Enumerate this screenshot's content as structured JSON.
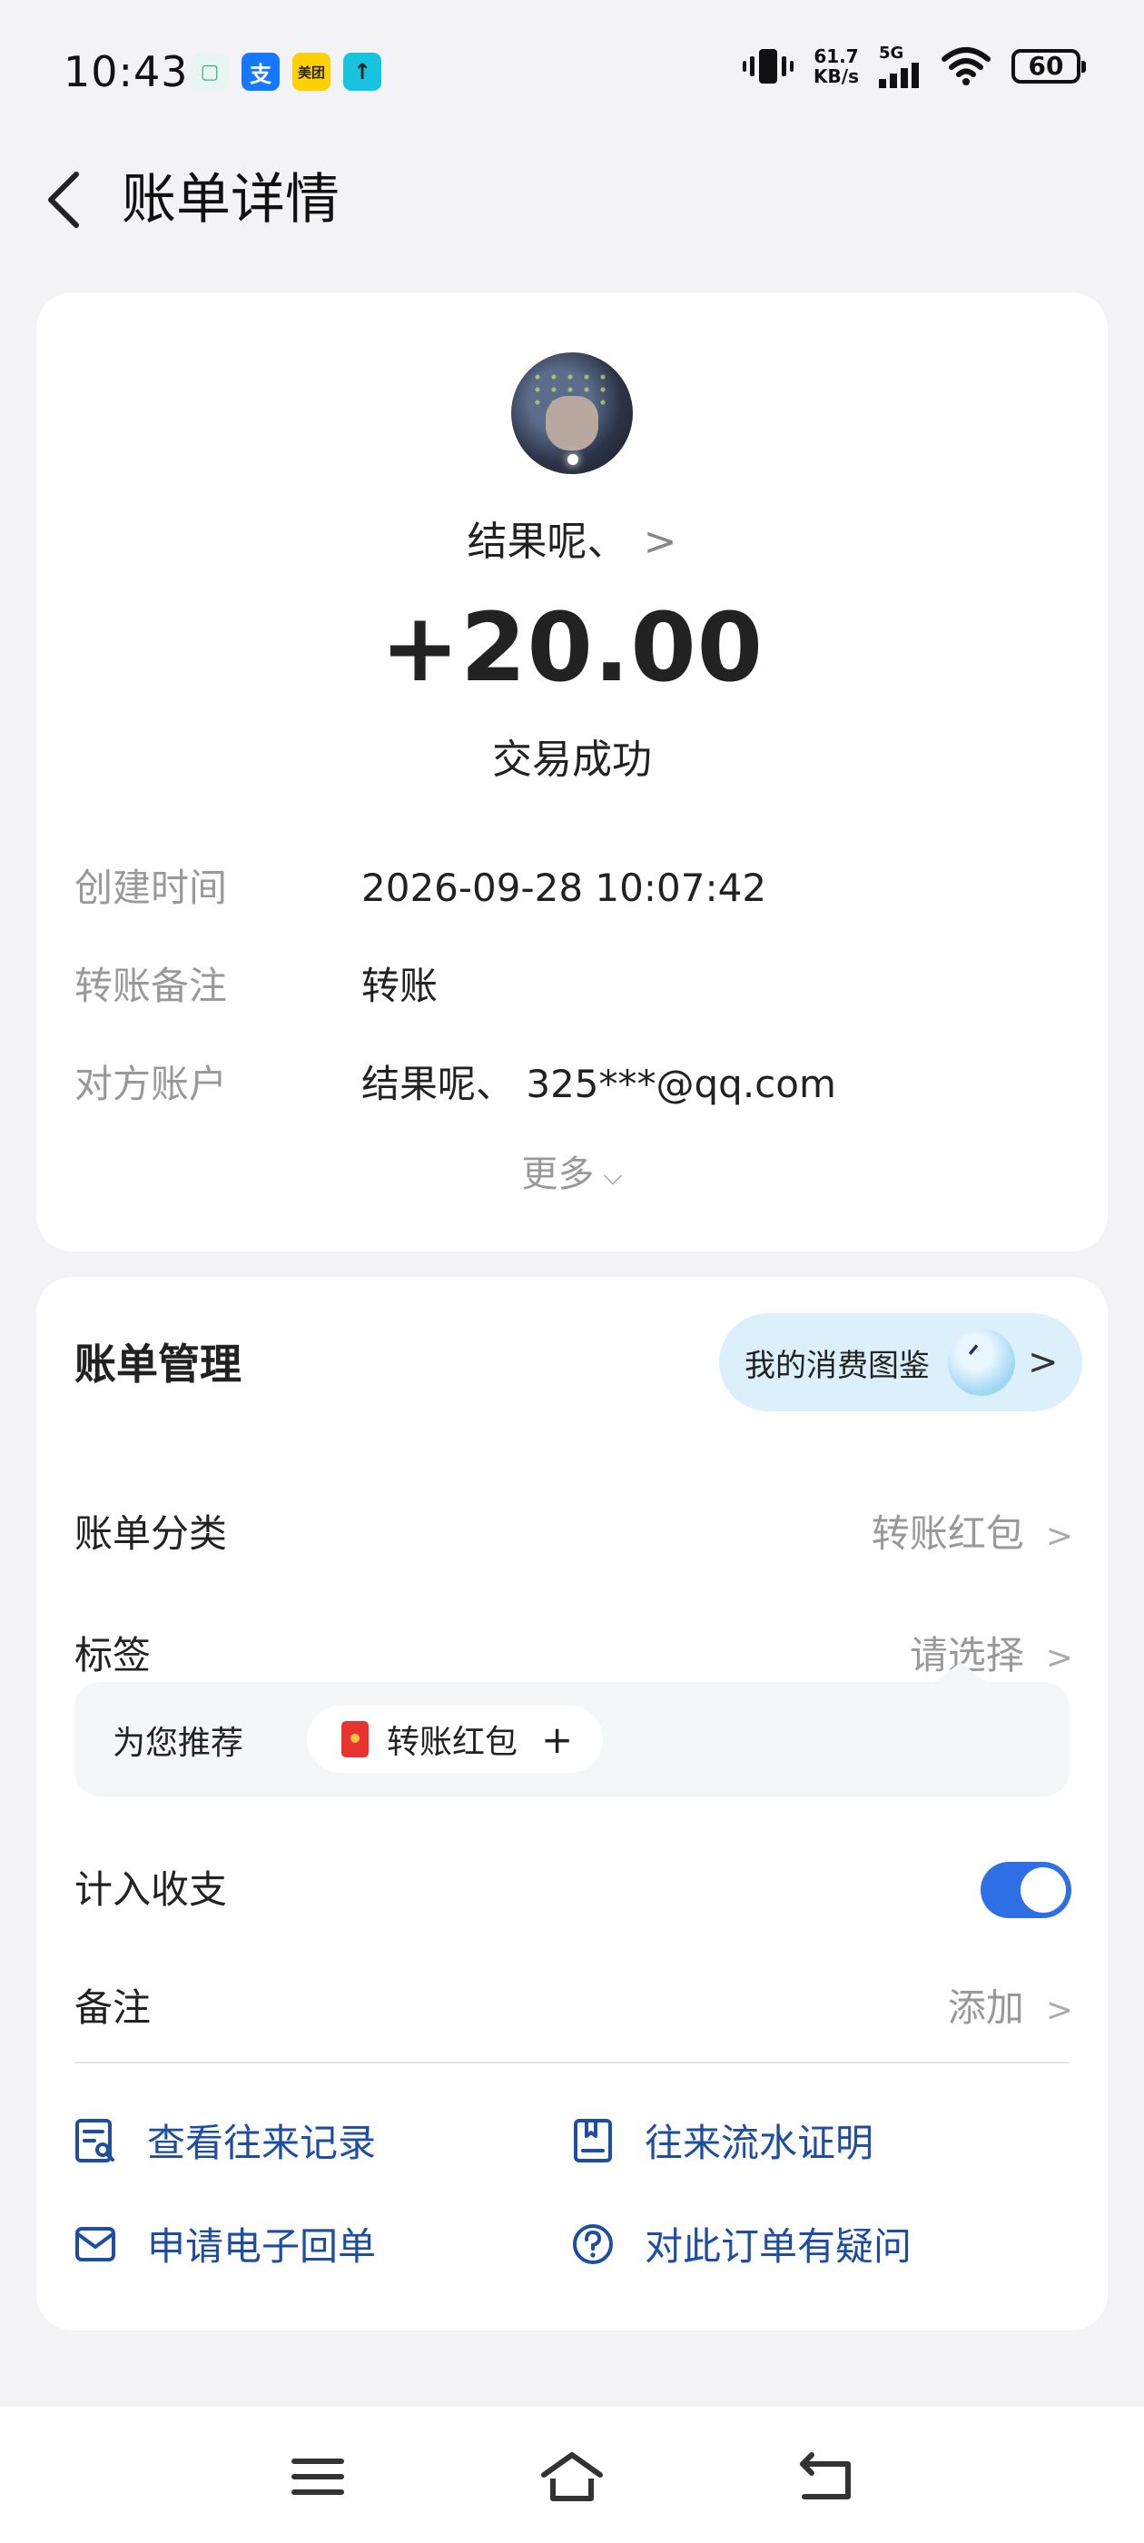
{
  "status_bar": {
    "time": "10:43",
    "apps": [
      {
        "icon": "message-app-icon",
        "glyph": "▢"
      },
      {
        "icon": "alipay-app-icon",
        "glyph": "支"
      },
      {
        "icon": "meituan-app-icon",
        "glyph": "美团"
      },
      {
        "icon": "upload-app-icon",
        "glyph": "↑"
      }
    ],
    "net_speed_value": "61.7",
    "net_speed_unit": "KB/s",
    "network": "5G",
    "battery": "60"
  },
  "header": {
    "title": "账单详情"
  },
  "transaction": {
    "name": "结果呢、",
    "amount": "+20.00",
    "status": "交易成功",
    "details": [
      {
        "key": "创建时间",
        "value": "2026-09-28 10:07:42"
      },
      {
        "key": "转账备注",
        "value": "转账"
      },
      {
        "key": "对方账户",
        "value": "结果呢、 325***@qq.com"
      }
    ],
    "more_label": "更多"
  },
  "management": {
    "title": "账单管理",
    "pill_label": "我的消费图鉴",
    "category_label": "账单分类",
    "category_value": "转账红包",
    "tag_label": "标签",
    "tag_value": "请选择",
    "reco_label": "为您推荐",
    "reco_chip": "转账红包",
    "include_label": "计入收支",
    "include_on": true,
    "note_label": "备注",
    "note_value": "添加",
    "actions": [
      {
        "label": "查看往来记录",
        "icon": "records-search-icon"
      },
      {
        "label": "往来流水证明",
        "icon": "statement-proof-icon"
      },
      {
        "label": "申请电子回单",
        "icon": "mail-receipt-icon"
      },
      {
        "label": "对此订单有疑问",
        "icon": "question-icon"
      }
    ]
  },
  "colors": {
    "accent_blue": "#2f6fe6",
    "action_text": "#1d4ea1",
    "pill_bg": "#dcf0fb",
    "red_envelope": "#e8332f"
  }
}
